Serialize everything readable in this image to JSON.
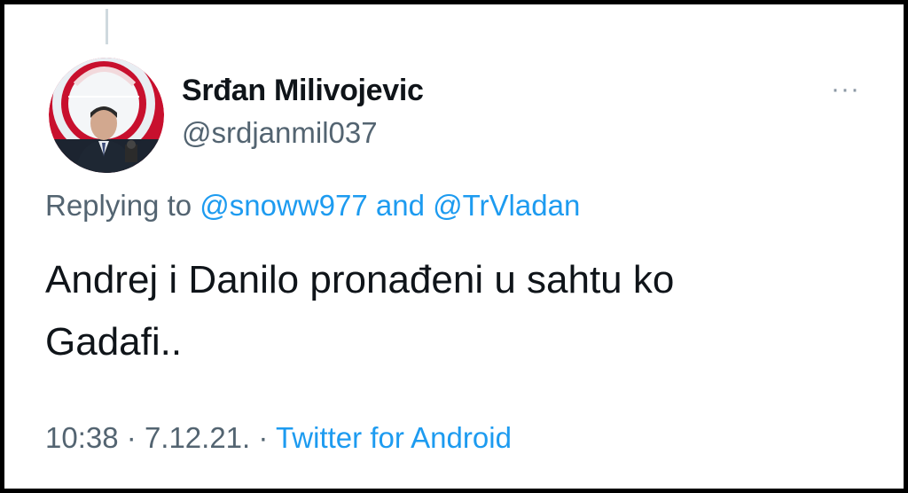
{
  "tweet": {
    "author": {
      "display_name": "Srđan Milivojevic",
      "handle": "@srdjanmil037"
    },
    "more_label": "···",
    "reply": {
      "prefix": "Replying to",
      "user1": "@snoww977",
      "connector": "and",
      "user2": "@TrVladan"
    },
    "text_line1": "Andrej i Danilo pronađeni u sahtu ko",
    "text_line2": "Gadafi..",
    "meta": {
      "time": "10:38",
      "sep1": "·",
      "date": "7.12.21.",
      "sep2": "·",
      "source": "Twitter for Android"
    }
  },
  "colors": {
    "link": "#1d9bf0",
    "muted": "#536471",
    "text": "#0f1419"
  },
  "icons": {
    "avatar": "profile-photo",
    "more": "more-options-icon"
  }
}
